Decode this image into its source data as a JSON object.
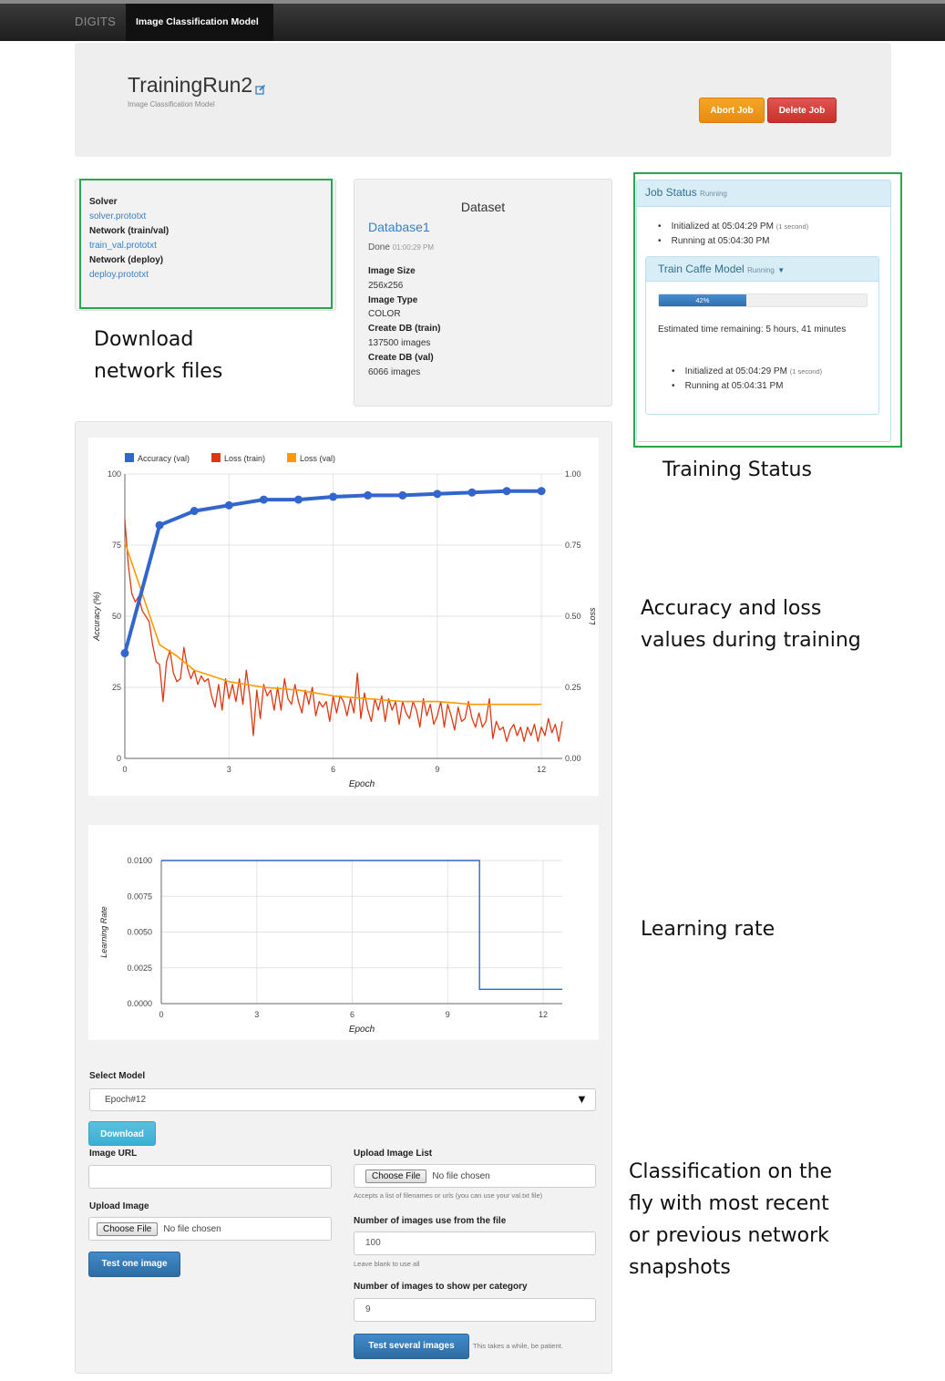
{
  "nav": {
    "brand": "DIGITS",
    "active": "Image Classification Model"
  },
  "header": {
    "title": "TrainingRun2",
    "subtitle": "Image Classification Model",
    "abort_label": "Abort Job",
    "delete_label": "Delete Job"
  },
  "files": {
    "solver_label": "Solver",
    "solver_link": "solver.prototxt",
    "trainval_label": "Network (train/val)",
    "trainval_link": "train_val.prototxt",
    "deploy_label": "Network (deploy)",
    "deploy_link": "deploy.prototxt"
  },
  "dataset": {
    "title": "Dataset",
    "name": "Database1",
    "done": "Done",
    "done_time": "01:00:29 PM",
    "image_size_label": "Image Size",
    "image_size": "256x256",
    "image_type_label": "Image Type",
    "image_type": "COLOR",
    "create_train_label": "Create DB (train)",
    "create_train": "137500 images",
    "create_val_label": "Create DB (val)",
    "create_val": "6066 images"
  },
  "status": {
    "title": "Job Status",
    "state": "Running",
    "init_text": "Initialized at 05:04:29 PM",
    "init_note": "(1 second)",
    "run_text": "Running at 05:04:30 PM",
    "task_title": "Train Caffe Model",
    "task_state": "Running",
    "progress_label": "42%",
    "progress": 0.42,
    "eta": "Estimated time remaining: 5 hours, 41 minutes",
    "task_init_text": "Initialized at 05:04:29 PM",
    "task_init_note": "(1 second)",
    "task_run_text": "Running at 05:04:31 PM"
  },
  "annotations": {
    "download": [
      "Download",
      "network files"
    ],
    "training_status": "Training Status",
    "accuracy_loss": [
      "Accuracy and loss",
      "values during training"
    ],
    "learning_rate": "Learning rate",
    "classification": [
      "Classification on the",
      "fly with most recent",
      "or previous network",
      "snapshots"
    ]
  },
  "chart_data": [
    {
      "type": "line",
      "legend": [
        "Accuracy (val)",
        "Loss (train)",
        "Loss (val)"
      ],
      "legend_position": "top-left",
      "xlabel": "Epoch",
      "ylabel": "Accuracy (%)",
      "y2label": "Loss",
      "x_ticks": [
        "0",
        "3",
        "6",
        "9",
        "12"
      ],
      "y_ticks": [
        "0",
        "25",
        "50",
        "75",
        "100"
      ],
      "y2_ticks": [
        "0.00",
        "0.25",
        "0.50",
        "0.75",
        "1.00"
      ],
      "xlim": [
        0,
        12.6
      ],
      "ylim": [
        0,
        100
      ],
      "y2lim": [
        0,
        1
      ],
      "colors": {
        "accuracy": "#3366cc",
        "loss_train": "#dc3912",
        "loss_val": "#ff9900"
      },
      "series": [
        {
          "name": "Accuracy (val)",
          "axis": "left",
          "markers": true,
          "x": [
            0,
            1,
            2,
            3,
            4,
            5,
            6,
            7,
            8,
            9,
            10,
            11,
            12
          ],
          "y": [
            37,
            82,
            87,
            89,
            91,
            91,
            92,
            92.5,
            92.5,
            93,
            93.5,
            94,
            94
          ]
        },
        {
          "name": "Loss (val)",
          "axis": "right",
          "markers": false,
          "x": [
            0,
            1,
            1.5,
            2,
            3,
            4,
            5,
            6,
            7,
            8,
            9,
            10,
            11,
            12
          ],
          "y": [
            0.76,
            0.4,
            0.36,
            0.31,
            0.27,
            0.25,
            0.24,
            0.22,
            0.21,
            0.2,
            0.2,
            0.19,
            0.19,
            0.19
          ]
        },
        {
          "name": "Loss (train)",
          "axis": "right",
          "markers": false,
          "x": [
            0,
            0.1,
            0.2,
            0.3,
            0.4,
            0.5,
            0.6,
            0.7,
            0.8,
            0.9,
            1.0,
            1.1,
            1.2,
            1.3,
            1.4,
            1.5,
            1.6,
            1.7,
            1.8,
            1.9,
            2.0,
            2.1,
            2.2,
            2.3,
            2.4,
            2.5,
            2.6,
            2.7,
            2.8,
            2.9,
            3.0,
            3.1,
            3.2,
            3.3,
            3.4,
            3.5,
            3.6,
            3.7,
            3.8,
            3.9,
            4.0,
            4.1,
            4.2,
            4.3,
            4.4,
            4.5,
            4.6,
            4.7,
            4.8,
            4.9,
            5.0,
            5.1,
            5.2,
            5.3,
            5.4,
            5.5,
            5.6,
            5.7,
            5.8,
            5.9,
            6.0,
            6.1,
            6.2,
            6.3,
            6.4,
            6.5,
            6.6,
            6.7,
            6.8,
            6.9,
            7.0,
            7.1,
            7.2,
            7.3,
            7.4,
            7.5,
            7.6,
            7.7,
            7.8,
            7.9,
            8.0,
            8.1,
            8.2,
            8.3,
            8.4,
            8.5,
            8.6,
            8.7,
            8.8,
            8.9,
            9.0,
            9.1,
            9.2,
            9.3,
            9.4,
            9.5,
            9.6,
            9.7,
            9.8,
            9.9,
            10.0,
            10.1,
            10.2,
            10.3,
            10.4,
            10.5,
            10.6,
            10.7,
            10.8,
            10.9,
            11.0,
            11.1,
            11.2,
            11.3,
            11.4,
            11.5,
            11.6,
            11.7,
            11.8,
            11.9,
            12.0,
            12.1,
            12.2,
            12.3,
            12.4,
            12.5,
            12.6
          ],
          "y": [
            0.84,
            0.68,
            0.58,
            0.55,
            0.57,
            0.52,
            0.5,
            0.48,
            0.4,
            0.34,
            0.33,
            0.2,
            0.34,
            0.38,
            0.3,
            0.27,
            0.28,
            0.39,
            0.32,
            0.28,
            0.31,
            0.26,
            0.29,
            0.27,
            0.28,
            0.22,
            0.18,
            0.26,
            0.17,
            0.28,
            0.21,
            0.26,
            0.2,
            0.28,
            0.19,
            0.31,
            0.22,
            0.08,
            0.24,
            0.14,
            0.26,
            0.22,
            0.24,
            0.17,
            0.25,
            0.17,
            0.28,
            0.21,
            0.19,
            0.26,
            0.2,
            0.16,
            0.24,
            0.19,
            0.25,
            0.15,
            0.2,
            0.18,
            0.2,
            0.13,
            0.22,
            0.16,
            0.22,
            0.2,
            0.15,
            0.21,
            0.16,
            0.3,
            0.14,
            0.23,
            0.17,
            0.13,
            0.21,
            0.17,
            0.22,
            0.13,
            0.21,
            0.17,
            0.2,
            0.12,
            0.2,
            0.16,
            0.14,
            0.2,
            0.17,
            0.11,
            0.21,
            0.15,
            0.19,
            0.12,
            0.15,
            0.2,
            0.11,
            0.19,
            0.15,
            0.1,
            0.18,
            0.13,
            0.14,
            0.2,
            0.14,
            0.11,
            0.16,
            0.11,
            0.13,
            0.21,
            0.07,
            0.13,
            0.1,
            0.11,
            0.06,
            0.1,
            0.12,
            0.08,
            0.11,
            0.06,
            0.11,
            0.08,
            0.12,
            0.06,
            0.11,
            0.08,
            0.14,
            0.09,
            0.12,
            0.06,
            0.13
          ]
        }
      ]
    },
    {
      "type": "line",
      "xlabel": "Epoch",
      "ylabel": "Learning Rate",
      "x_ticks": [
        "0",
        "3",
        "6",
        "9",
        "12"
      ],
      "y_ticks": [
        "0.0000",
        "0.0025",
        "0.0050",
        "0.0075",
        "0.0100"
      ],
      "xlim": [
        0,
        12.6
      ],
      "ylim": [
        0,
        0.01
      ],
      "colors": {
        "lr": "#3366cc"
      },
      "series": [
        {
          "name": "",
          "x": [
            0,
            10,
            10,
            12.6
          ],
          "y": [
            0.01,
            0.01,
            0.001,
            0.001
          ]
        }
      ]
    }
  ],
  "form": {
    "select_model_label": "Select Model",
    "selected_model": "Epoch#12",
    "download_label": "Download",
    "image_url_label": "Image URL",
    "image_url_value": "",
    "upload_image_label": "Upload Image",
    "choose_file": "Choose File",
    "no_file": "No file chosen",
    "test_one_label": "Test one image",
    "upload_list_label": "Upload Image List",
    "list_help": "Accepts a list of filenames or urls (you can use your val.txt file)",
    "num_images_label": "Number of images use from the file",
    "num_images_value": "100",
    "num_images_help": "Leave blank to use all",
    "per_category_label": "Number of images to show per category",
    "per_category_value": "9",
    "test_several_label": "Test several images",
    "test_several_help": "This takes a while, be patient."
  }
}
